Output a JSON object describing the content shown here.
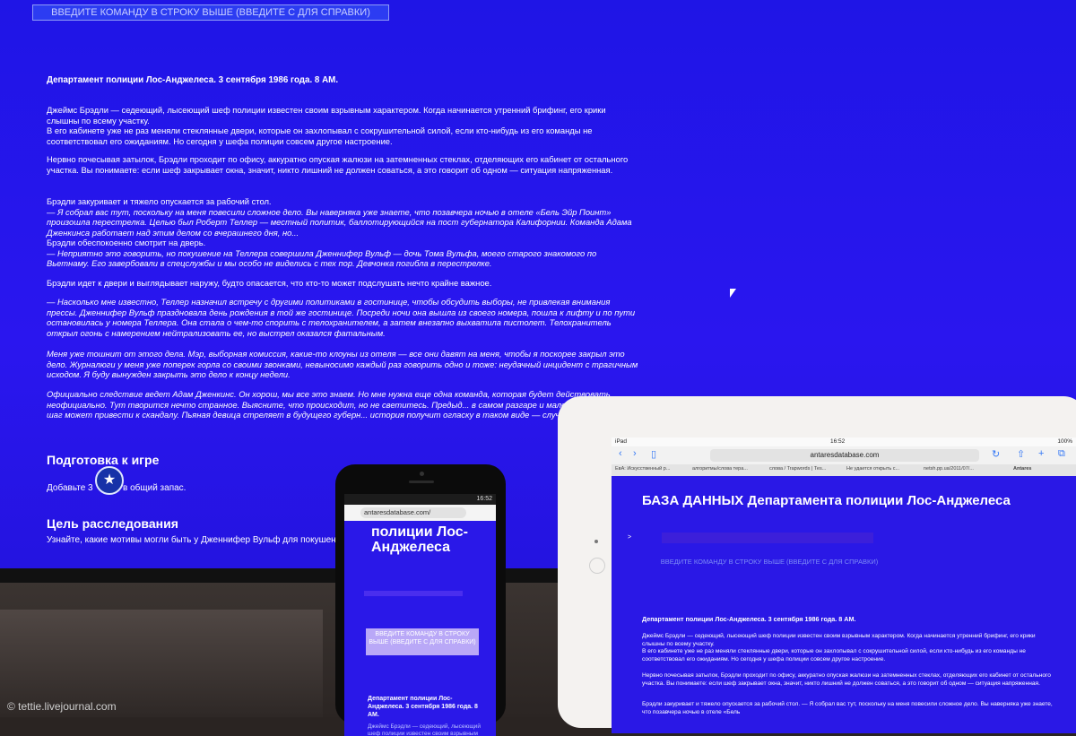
{
  "monitor": {
    "hint": "ВВЕДИТЕ КОМАНДУ В СТРОКУ ВЫШЕ (ВВЕДИТЕ С ДЛЯ СПРАВКИ)",
    "heading": "Департамент полиции Лос-Анджелеса. 3 сентября 1986 года. 8 AM.",
    "paragraphs": [
      "Джеймс Брэдли — седеющий, лысеющий шеф полиции известен своим взрывным характером. Когда начинается утренний брифинг, его крики слышны по всему участку.",
      "В его кабинете уже не раз меняли стеклянные двери, которые он захлопывал с сокрушительной силой, если кто-нибудь из его команды не соответствовал его ожиданиям. Но сегодня у шефа полиции совсем другое настроение.",
      "Нервно почесывая затылок, Брэдли проходит по офису, аккуратно опуская жалюзи на затемненных стеклах, отделяющих его кабинет от остального участка. Вы понимаете: если шеф закрывает окна, значит, никто лишний не должен соваться, а это говорит об одном — ситуация напряженная.",
      "Брэдли закуривает и тяжело опускается за рабочий стол.",
      "— Я собрал вас тут, поскольку на меня повесили сложное дело. Вы наверняка уже знаете, что позавчера ночью в отеле «Бель Эйр Поинт» произошла перестрелка. Целью был Роберт Теллер — местный политик, баллотирующийся на пост губернатора Калифорнии. Команда Адама Дженкинса работает над этим делом со вчерашнего дня, но...",
      "Брэдли обеспокоенно смотрит на дверь.",
      "— Неприятно это говорить, но покушение на Теллера совершила Дженнифер Вульф — дочь Тома Вульфа, моего старого знакомого по Вьетнаму. Его завербовали в спецслужбы и мы особо не виделись с тех пор. Девчонка погибла в перестрелке.",
      "Брэдли идет к двери и выглядывает наружу, будто опасается, что кто-то может подслушать нечто крайне важное.",
      "— Насколько мне известно, Теллер назначил встречу с другими политиками в гостинице, чтобы обсудить выборы, не привлекая внимания прессы. Дженнифер Вульф праздновала день рождения в той же гостинице. Посреди ночи она вышла из своего номера, пошла к лифту и по пути остановилась у номера Теллера. Она стала о чем-то спорить с телохранителем, а затем внезапно выхватила пистолет. Телохранитель открыл огонь с намерением нейтрализовать ее, но выстрел оказался фатальным.",
      "Меня уже тошнит от этого дела. Мэр, выборная комиссия, какие-то клоуны из отеля — все они давят на меня, чтобы я поскорее закрыл это дело. Журналюги у меня уже поперек горла со своими звонками, невыносимо каждый раз говорить одно и тоже: неудачный инцидент с трагичным исходом. Я буду вынужден закрыть это дело к концу недели.",
      "Официально следствие ведет Адам Дженкинс. Он хорош, мы все это знаем. Но мне нужна еще одна команда, которая будет действовать неофициально. Тут творится нечто странное. Выясните, что происходит, но не светитесь. Предыд... в самом разгаре и малейший неверный шаг может привести к скандалу. Пьяная девица стреляет в будущего губерн... история получит огласку в таком виде — случится катастрофа."
    ],
    "prep_title": "Подготовка к игре",
    "prep_text_a": "Добавьте 3",
    "prep_text_b": "в общий запас.",
    "goal_title": "Цель расследования",
    "goal_text": "Узнайте, какие мотивы могли быть у Дженнифер Вульф для покушени... пистолет."
  },
  "phone": {
    "status": "16:52",
    "url": "antaresdatabase.com/",
    "title": "полиции Лос-Анджелеса",
    "hint": "ВВЕДИТЕ КОМАНДУ В СТРОКУ ВЫШЕ (ВВЕДИТЕ С ДЛЯ СПРАВКИ)",
    "dept": "Департамент полиции Лос-Анджелеса. 3 сентября 1986 года. 8 AM.",
    "body": "Джеймс Брэдли — седеющий, лысеющий шеф полиции известен своим взрывным характером. Когда начинается утренний брифинг, его крики слышны"
  },
  "tablet": {
    "status_left": "iPad",
    "status_time": "16:52",
    "status_right": "100%",
    "url": "antaresdatabase.com",
    "tabs": [
      "ЕвА: Искусственный р...",
      "алгоритмы/слова тера...",
      "слова / Trapwords | Теs...",
      "Не удается открыть с...",
      "netsh.pp.ua/2011/07/...",
      "Antares"
    ],
    "title": "БАЗА ДАННЫХ Департамента полиции Лос-Анджелеса",
    "prompt": ">",
    "hint": "ВВЕДИТЕ КОМАНДУ В СТРОКУ ВЫШЕ (ВВЕДИТЕ С ДЛЯ СПРАВКИ)",
    "dept": "Департамент полиции Лос-Анджелеса. 3 сентября 1986 года. 8 AM.",
    "body": [
      "Джеймс Брэдли — седеющий, лысеющий шеф полиции известен своим взрывным характером. Когда начинается утренний брифинг, его крики слышны по всему участку.",
      "В его кабинете уже не раз меняли стеклянные двери, которые он захлопывал с сокрушительной силой, если кто-нибудь из его команды не соответствовал его ожиданиям. Но сегодня у шефа полиции совсем другое настроение.",
      "Нервно почесывая затылок, Брэдли проходит по офису, аккуратно опуская жалюзи на затемненных стеклах, отделяющих его кабинет от остального участка. Вы понимаете: если шеф закрывает окна, значит, никто лишний не должен соваться, а это говорит об одном — ситуация напряженная.",
      "Брэдли закуривает и тяжело опускается за рабочий стол. — Я собрал вас тут, поскольку на меня повесили сложное дело. Вы наверняка уже знаете, что позавчера ночью в отеле «Бель"
    ]
  },
  "watermark": "© tettie.livejournal.com",
  "colors": {
    "screen_blue": "#2414e0",
    "text": "#ffffff"
  }
}
